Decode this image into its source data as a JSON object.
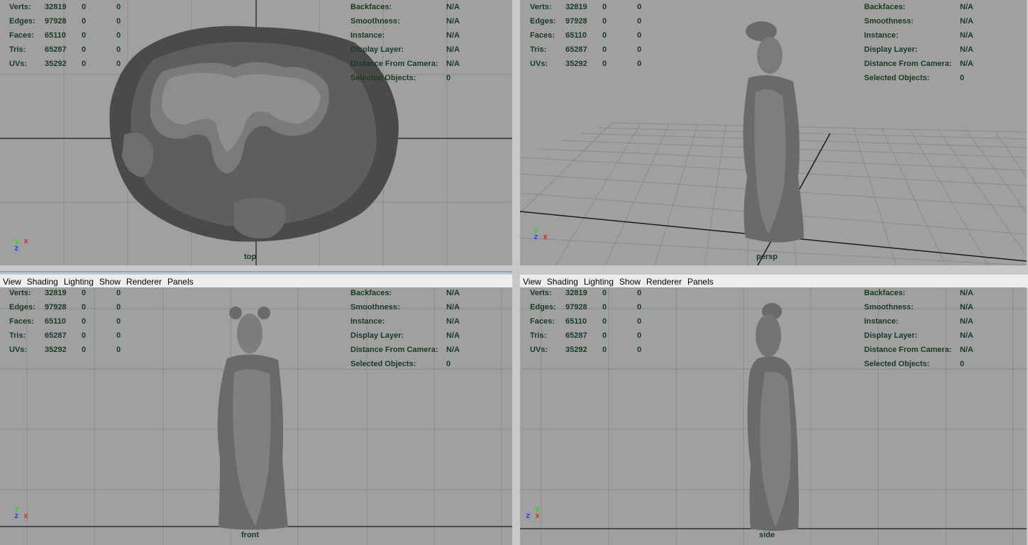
{
  "menu": {
    "view": "View",
    "shading": "Shading",
    "lighting": "Lighting",
    "show": "Show",
    "renderer": "Renderer",
    "panels": "Panels"
  },
  "hud_left": {
    "verts": {
      "label": "Verts:",
      "a": "32819",
      "b": "0",
      "c": "0"
    },
    "edges": {
      "label": "Edges:",
      "a": "97928",
      "b": "0",
      "c": "0"
    },
    "faces": {
      "label": "Faces:",
      "a": "65110",
      "b": "0",
      "c": "0"
    },
    "tris": {
      "label": "Tris:",
      "a": "65287",
      "b": "0",
      "c": "0"
    },
    "uvs": {
      "label": "UVs:",
      "a": "35292",
      "b": "0",
      "c": "0"
    }
  },
  "hud_right": {
    "backfaces": {
      "label": "Backfaces:",
      "value": "N/A"
    },
    "smoothness": {
      "label": "Smoothness:",
      "value": "N/A"
    },
    "instance": {
      "label": "Instance:",
      "value": "N/A"
    },
    "display_layer": {
      "label": "Display Layer:",
      "value": "N/A"
    },
    "distance": {
      "label": "Distance From Camera:",
      "value": "N/A"
    },
    "selected": {
      "label": "Selected Objects:",
      "value": "0"
    }
  },
  "cameras": {
    "top": "top",
    "persp": "persp",
    "front": "front",
    "side": "side"
  },
  "axes": {
    "x": "x",
    "y": "y",
    "z": "z"
  },
  "colors": {
    "viewport_bg": "#a0a0a0",
    "grid_line": "#8c8c8c",
    "axis_line": "#1a1a1a",
    "hud_text": "#163b25",
    "active_border": "#7aa6c8"
  }
}
